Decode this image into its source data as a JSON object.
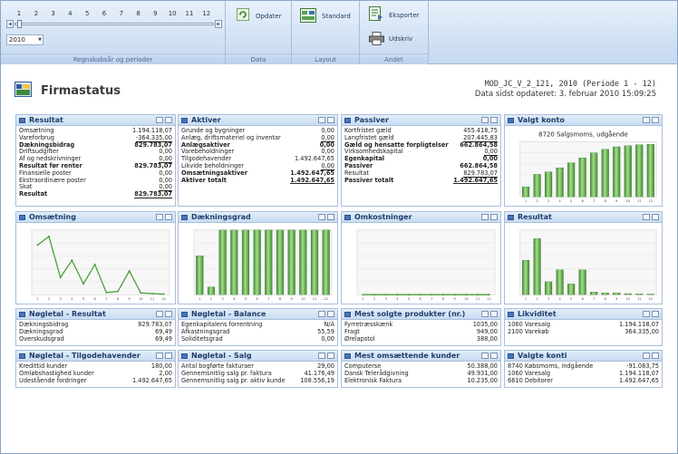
{
  "ribbon": {
    "period_ticks": [
      "1",
      "2",
      "3",
      "4",
      "5",
      "6",
      "7",
      "8",
      "9",
      "10",
      "11",
      "12"
    ],
    "year": "2010",
    "groups": {
      "periods": "Regnskabsår og perioder",
      "data": "Data",
      "layout": "Layout",
      "other": "Andet"
    },
    "buttons": {
      "update": "Opdater",
      "standard": "Standard",
      "export": "Eksporter",
      "print": "Udskriv"
    }
  },
  "header": {
    "title": "Firmastatus",
    "company": "MOD_JC_V_2_121, 2010 (Periode 1 - 12)",
    "updated": "Data sidst opdateret: 3. februar 2010 15:09:25"
  },
  "panels": {
    "resultat": {
      "title": "Resultat",
      "rows": [
        {
          "label": "Omsætning",
          "value": "1.194.118,07",
          "style": ""
        },
        {
          "label": "Vareforbrug",
          "value": "-364.335,00",
          "style": "ul"
        },
        {
          "label": "Dækningsbidrag",
          "value": "829.783,07",
          "style": "b"
        },
        {
          "label": "Driftsudgifter",
          "value": "0,00",
          "style": ""
        },
        {
          "label": "Af og nedskrivninger",
          "value": "0,00",
          "style": "ul"
        },
        {
          "label": "Resultat før renter",
          "value": "829.783,07",
          "style": "b"
        },
        {
          "label": "Finansielle poster",
          "value": "0,00",
          "style": ""
        },
        {
          "label": "Ekstraordinære poster",
          "value": "0,00",
          "style": ""
        },
        {
          "label": "Skat",
          "value": "0,00",
          "style": "ul"
        },
        {
          "label": "Resultat",
          "value": "829.783,07",
          "style": "b ul"
        }
      ]
    },
    "aktiver": {
      "title": "Aktiver",
      "rows": [
        {
          "label": "Grunde og bygninger",
          "value": "0,00",
          "style": ""
        },
        {
          "label": "Anlæg, driftsmateriel og inventar",
          "value": "0,00",
          "style": "ul"
        },
        {
          "label": "Anlægsaktiver",
          "value": "0,00",
          "style": "b"
        },
        {
          "label": "Varebeholdninger",
          "value": "0,00",
          "style": ""
        },
        {
          "label": "Tilgodehavender",
          "value": "1.492.647,65",
          "style": ""
        },
        {
          "label": "Likvide beholdninger",
          "value": "0,00",
          "style": "ul"
        },
        {
          "label": "Omsætningsaktiver",
          "value": "1.492.647,65",
          "style": "b"
        },
        {
          "label": "Aktiver totalt",
          "value": "1.492.647,65",
          "style": "b ul"
        }
      ]
    },
    "passiver": {
      "title": "Passiver",
      "rows": [
        {
          "label": "Kortfristet gæld",
          "value": "455.418,75",
          "style": ""
        },
        {
          "label": "Langfristet gæld",
          "value": "207.445,83",
          "style": "ul"
        },
        {
          "label": "Gæld og hensatte forpligtelser",
          "value": "662.864,58",
          "style": "b"
        },
        {
          "label": "Virksomhedskapital",
          "value": "0,00",
          "style": "ul"
        },
        {
          "label": "Egenkapital",
          "value": "0,00",
          "style": "b"
        },
        {
          "label": "Passiver",
          "value": "662.864,58",
          "style": "b"
        },
        {
          "label": "Resultat",
          "value": "829.783,07",
          "style": "ul"
        },
        {
          "label": "Passiver totalt",
          "value": "1.492.647,65",
          "style": "b ul"
        }
      ]
    },
    "valgt_konto": {
      "title": "Valgt konto",
      "chart_title": "8720 Salgsmoms, udgående"
    },
    "omsaetning": {
      "title": "Omsætning"
    },
    "daekningsgrad": {
      "title": "Dækningsgrad"
    },
    "omkostninger": {
      "title": "Omkostninger"
    },
    "resultat_chart": {
      "title": "Resultat"
    },
    "noegletal_resultat": {
      "title": "Nøgletal - Resultat",
      "rows": [
        {
          "label": "Dækningsbidrag",
          "value": "829.783,07"
        },
        {
          "label": "Dækningsgrad",
          "value": "69,49"
        },
        {
          "label": "Overskudsgrad",
          "value": "69,49"
        }
      ]
    },
    "noegletal_balance": {
      "title": "Nøgletal - Balance",
      "rows": [
        {
          "label": "Egenkapitalens forrentning",
          "value": "N/A"
        },
        {
          "label": "Afkastningsgrad",
          "value": "55,59"
        },
        {
          "label": "Soliditetsgrad",
          "value": "0,00"
        }
      ]
    },
    "mest_solgte": {
      "title": "Mest solgte produkter (nr.)",
      "rows": [
        {
          "label": "Fyrretræsskænk",
          "value": "1035,00"
        },
        {
          "label": "Fragt",
          "value": "949,00"
        },
        {
          "label": "Ørelapstol",
          "value": "388,00"
        }
      ]
    },
    "likviditet": {
      "title": "Likviditet",
      "rows": [
        {
          "label": "1060 Varesalg",
          "value": "1.194.118,07"
        },
        {
          "label": "2100 Varekøb",
          "value": "364.335,00"
        }
      ]
    },
    "noegletal_tilgode": {
      "title": "Nøgletal - Tilgodehavender",
      "rows": [
        {
          "label": "Kredittid kunder",
          "value": "180,00"
        },
        {
          "label": "Omløbshastighed kunder",
          "value": "2,00"
        },
        {
          "label": "Udestående fordringer",
          "value": "1.492.647,65"
        }
      ]
    },
    "noegletal_salg": {
      "title": "Nøgletal - Salg",
      "rows": [
        {
          "label": "Antal bogførte fakturaer",
          "value": "29,00"
        },
        {
          "label": "Gennemsnitlig salg pr. faktura",
          "value": "41.176,49"
        },
        {
          "label": "Gennemsnitlig salg pr. aktiv kunde",
          "value": "108.556,19"
        }
      ]
    },
    "mest_omsaettende": {
      "title": "Mest omsættende kunder",
      "rows": [
        {
          "label": "Computerse",
          "value": "50.388,00"
        },
        {
          "label": "Dansk Telerådgivning",
          "value": "49.931,00"
        },
        {
          "label": "Elektronisk Faktura",
          "value": "10.235,00"
        }
      ]
    },
    "valgte_konti": {
      "title": "Valgte konti",
      "rows": [
        {
          "label": "8740 Købsmoms, indgående",
          "value": "-91.083,75"
        },
        {
          "label": "1060 Varesalg",
          "value": "1.194.118,07"
        },
        {
          "label": "6610 Debitorer",
          "value": "1.492.647,65"
        }
      ]
    }
  },
  "chart_data": [
    {
      "type": "bar",
      "name": "Valgt konto",
      "title": "8720 Salgsmoms, udgående",
      "categories": [
        "1",
        "2",
        "3",
        "4",
        "5",
        "6",
        "7",
        "8",
        "9",
        "10",
        "11",
        "12"
      ],
      "values": [
        20,
        45,
        50,
        58,
        68,
        78,
        88,
        95,
        100,
        102,
        104,
        105
      ],
      "ylim": [
        0,
        110
      ]
    },
    {
      "type": "line",
      "name": "Omsætning",
      "categories": [
        "1",
        "2",
        "3",
        "4",
        "5",
        "6",
        "7",
        "8",
        "9",
        "10",
        "11",
        "12"
      ],
      "values": [
        230000,
        270000,
        80000,
        160000,
        50000,
        140000,
        10000,
        15000,
        110000,
        8000,
        5000,
        3000
      ],
      "ylim": [
        0,
        300000
      ]
    },
    {
      "type": "bar",
      "name": "Dækningsgrad",
      "categories": [
        "1",
        "2",
        "3",
        "4",
        "5",
        "6",
        "7",
        "8",
        "9",
        "10",
        "11",
        "12"
      ],
      "values": [
        60,
        12,
        100,
        100,
        100,
        100,
        100,
        100,
        100,
        100,
        100,
        100
      ],
      "ylim": [
        0,
        100
      ]
    },
    {
      "type": "line",
      "name": "Omkostninger",
      "categories": [
        "1",
        "2",
        "3",
        "4",
        "5",
        "6",
        "7",
        "8",
        "9",
        "10",
        "11",
        "12"
      ],
      "values": [
        0,
        0,
        0,
        0,
        0,
        0,
        0,
        0,
        0,
        0,
        0,
        0
      ],
      "ylim": [
        0,
        100
      ]
    },
    {
      "type": "bar",
      "name": "Resultat",
      "categories": [
        "1",
        "2",
        "3",
        "4",
        "5",
        "6",
        "7",
        "8",
        "9",
        "10",
        "11",
        "12"
      ],
      "values": [
        160000,
        260000,
        60000,
        115000,
        50000,
        115000,
        12000,
        8000,
        8000,
        5000,
        4000,
        3000
      ],
      "ylim": [
        0,
        300000
      ]
    }
  ]
}
